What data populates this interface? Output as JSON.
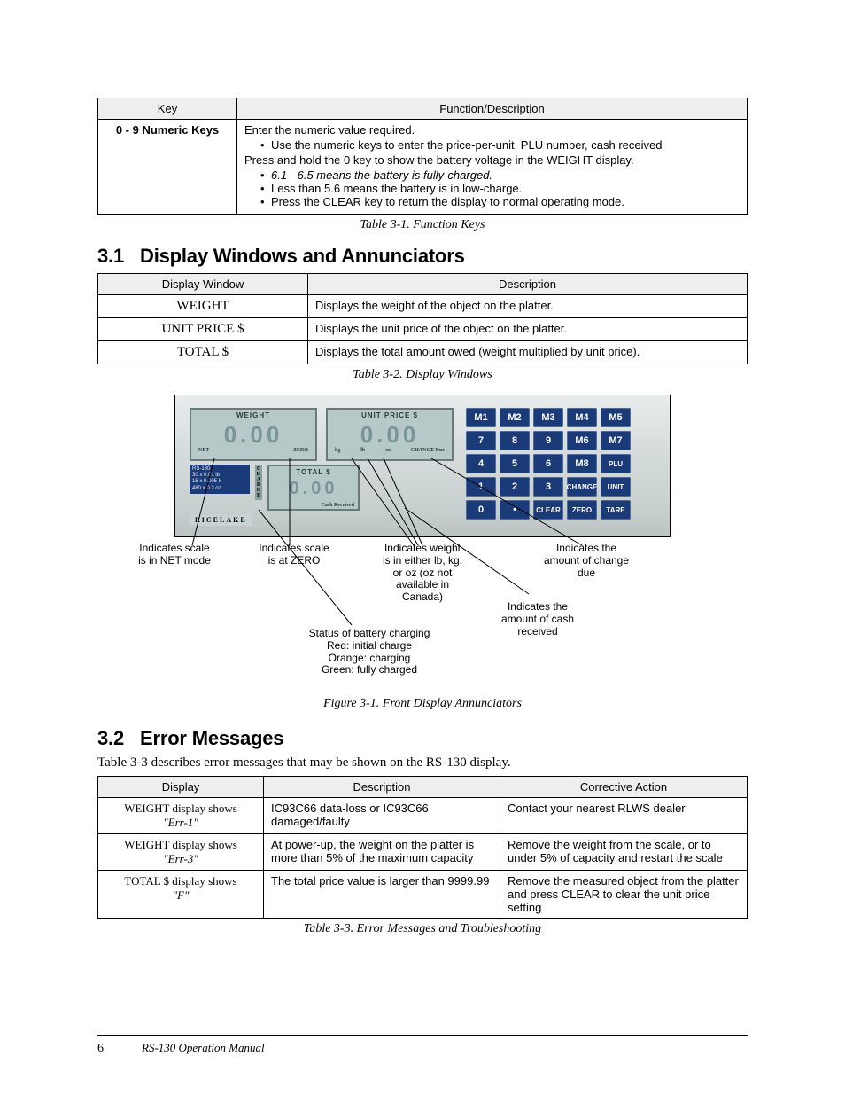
{
  "table1": {
    "headers": [
      "Key",
      "Function/Description"
    ],
    "row_key": "0 - 9 Numeric Keys",
    "desc_intro": "Enter the numeric value required.",
    "bullets": [
      "Use the numeric keys to enter the price-per-unit, PLU number, cash received",
      "Press and hold the 0 key to show the battery voltage in the WEIGHT display.",
      "6.1 - 6.5 means the battery is fully-charged.",
      "Less than 5.6 means the battery is in low-charge.",
      "Press the CLEAR key to return the display to normal operating mode."
    ],
    "caption": "Table 3-1. Function Keys"
  },
  "sec31": {
    "num": "3.1",
    "title": "Display Windows and Annunciators"
  },
  "table2": {
    "headers": [
      "Display Window",
      "Description"
    ],
    "rows": [
      {
        "w": "WEIGHT",
        "d": "Displays the weight of the object on the platter."
      },
      {
        "w": "UNIT PRICE $",
        "d": "Displays the unit price of the object on the platter."
      },
      {
        "w": "TOTAL $",
        "d": "Displays the total amount owed (weight multiplied by unit price)."
      }
    ],
    "caption": "Table 3-2. Display Windows"
  },
  "figure": {
    "lcd_weight_label": "WEIGHT",
    "lcd_weight_sub": [
      "NET",
      "ZERO"
    ],
    "lcd_unit_label": "UNIT   PRICE $",
    "lcd_unit_sub": [
      "kg",
      "lb",
      "oz",
      "CHANGE Due"
    ],
    "lcd_total_label": "TOTAL $",
    "lcd_total_sub": "Cash Received",
    "charge_label": "CHARGE",
    "digits": "0.00",
    "info_lines": "RS-130\n30 x 0.01 lb\n15 x 0.005 k\n480 x 0.2 oz",
    "rice": "RICELAKE",
    "keys": [
      "M1",
      "M2",
      "M3",
      "M4",
      "M5",
      "7",
      "8",
      "9",
      "M6",
      "M7",
      "4",
      "5",
      "6",
      "M8",
      "PLU",
      "1",
      "2",
      "3",
      "CHANGE",
      "UNIT",
      "0",
      "•",
      "CLEAR",
      "ZERO",
      "TARE"
    ],
    "callouts": {
      "net": "Indicates scale\nis in NET mode",
      "zero": "Indicates scale\nis at ZERO",
      "unit": "Indicates weight\nis in either lb, kg,\nor oz (oz not\navailable in\nCanada)",
      "change": "Indicates the\namount of change\ndue",
      "cash": "Indicates the\namount of cash\nreceived",
      "charge": "Status of battery charging\nRed: initial charge\nOrange: charging\nGreen: fully charged"
    },
    "caption": "Figure 3-1. Front Display Annunciators"
  },
  "sec32": {
    "num": "3.2",
    "title": "Error Messages"
  },
  "sec32_body": "Table 3-3 describes error messages that may be shown on the RS-130 display.",
  "table3": {
    "headers": [
      "Display",
      "Description",
      "Corrective Action"
    ],
    "rows": [
      {
        "a": "WEIGHT display shows \"Err-1\"",
        "b": "IC93C66 data-loss or IC93C66 damaged/faulty",
        "c": "Contact your nearest RLWS dealer"
      },
      {
        "a": "WEIGHT display shows \"Err-3\"",
        "b": "At power-up, the weight on the platter is more than 5% of the maximum capacity",
        "c": "Remove the weight from the scale, or to under 5% of capacity and restart the scale"
      },
      {
        "a": "TOTAL $ display shows \"F\"",
        "b": "The total price value is larger than 9999.99",
        "c": "Remove the measured object from the platter and press CLEAR to clear the unit price setting"
      }
    ],
    "caption": "Table 3-3. Error Messages and Troubleshooting"
  },
  "footer": {
    "page": "6",
    "manual": "RS-130 Operation Manual"
  }
}
